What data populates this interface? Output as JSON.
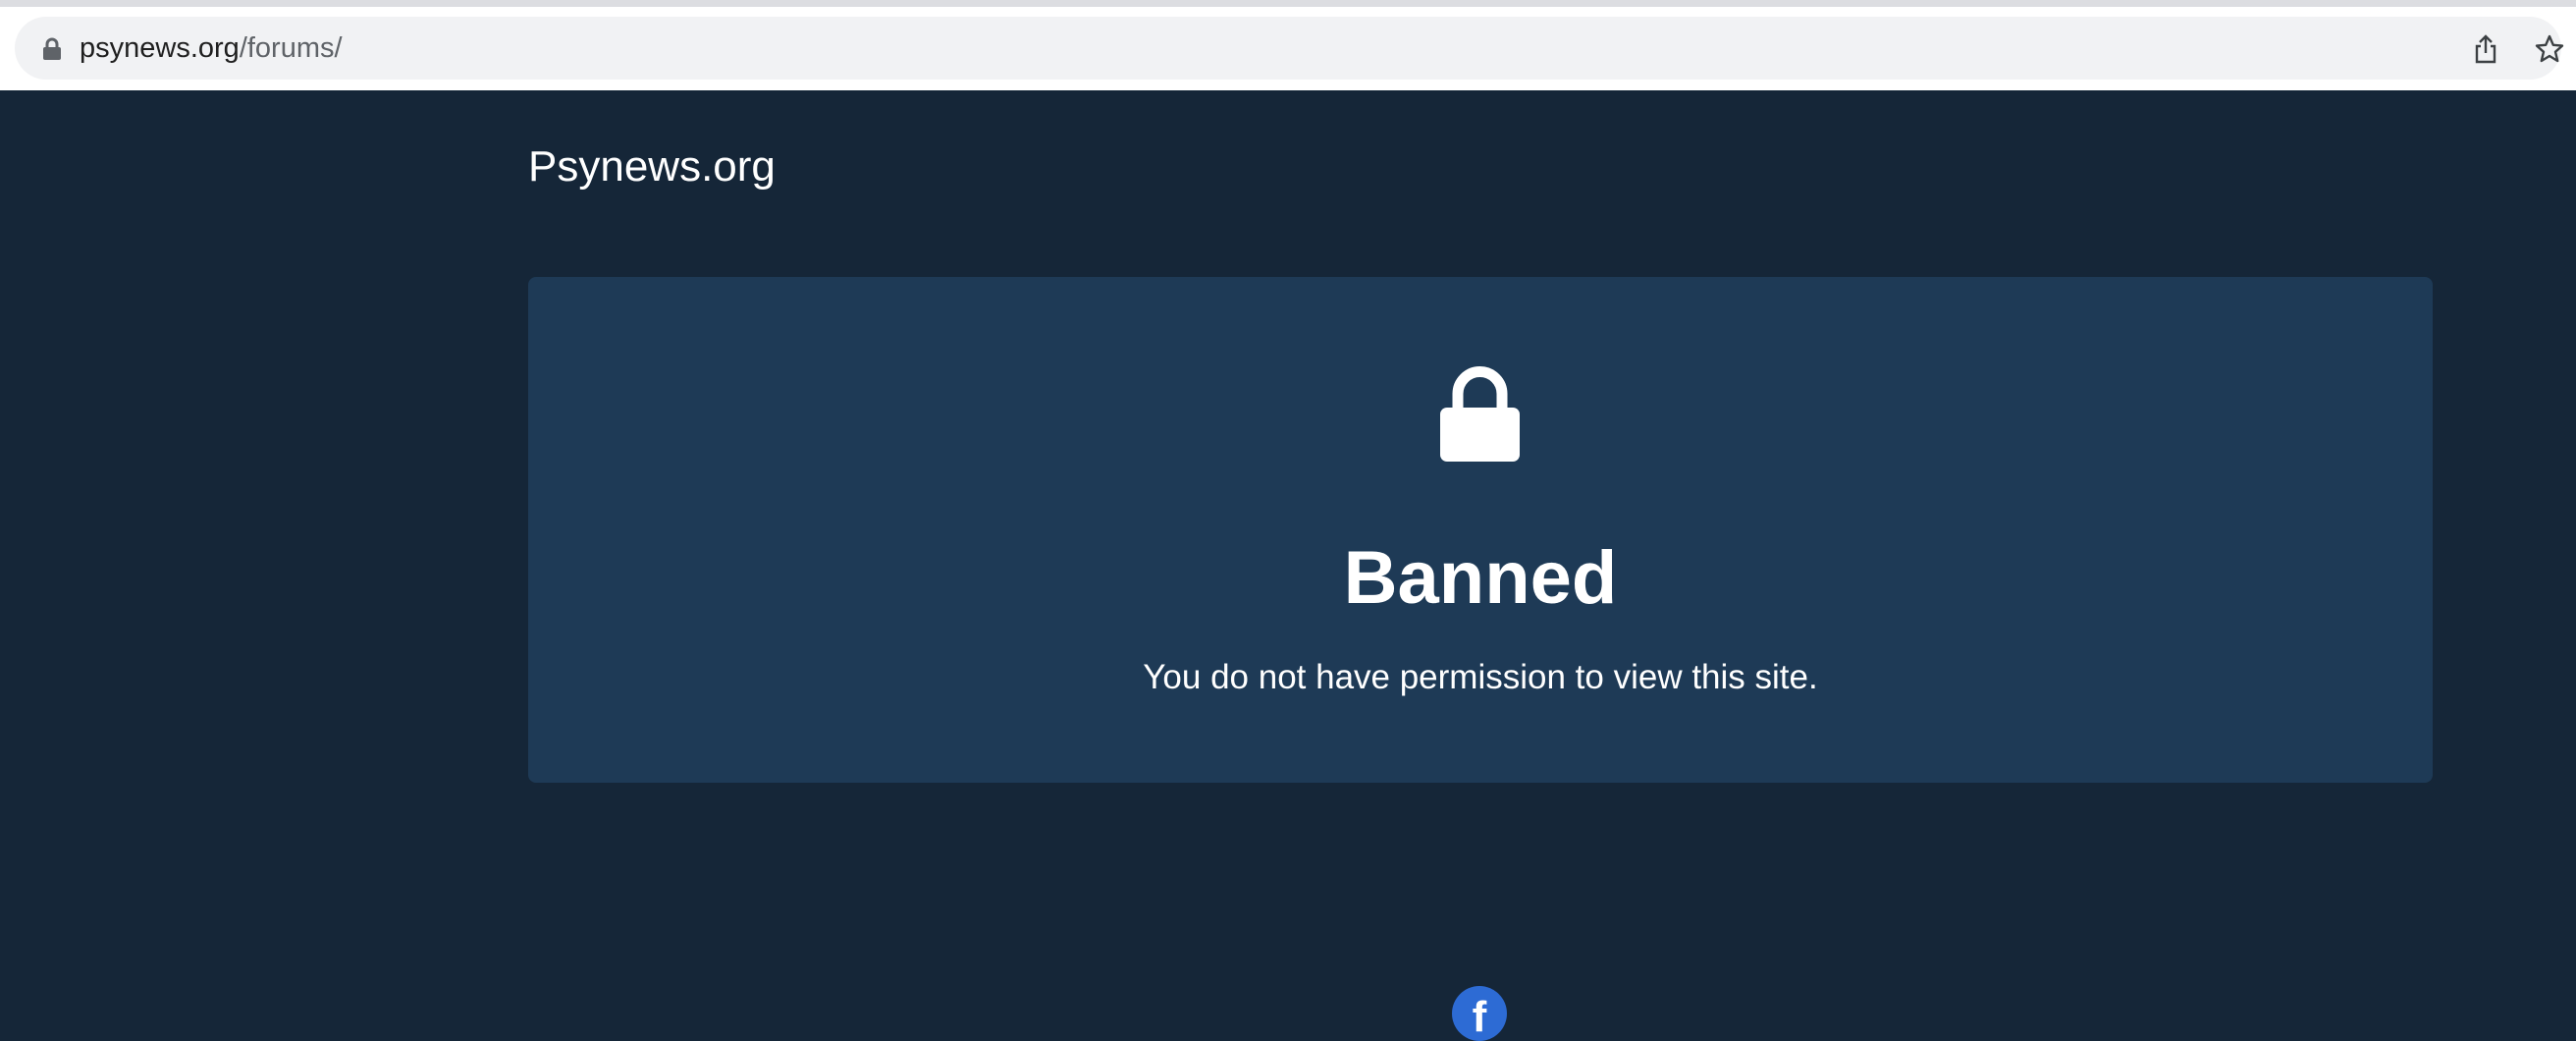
{
  "browser": {
    "url_domain": "psynews.org",
    "url_path": "/forums/"
  },
  "site": {
    "title": "Psynews.org"
  },
  "ban_notice": {
    "heading": "Banned",
    "message": "You do not have permission to view this site."
  },
  "footer": {
    "social_icon_letter": "f"
  },
  "colors": {
    "page_background": "#152638",
    "card_background": "#1e3a56",
    "facebook_blue": "#2d6bd4"
  },
  "icons": [
    "lock-icon",
    "share-icon",
    "star-icon",
    "padlock-icon",
    "facebook-icon"
  ]
}
